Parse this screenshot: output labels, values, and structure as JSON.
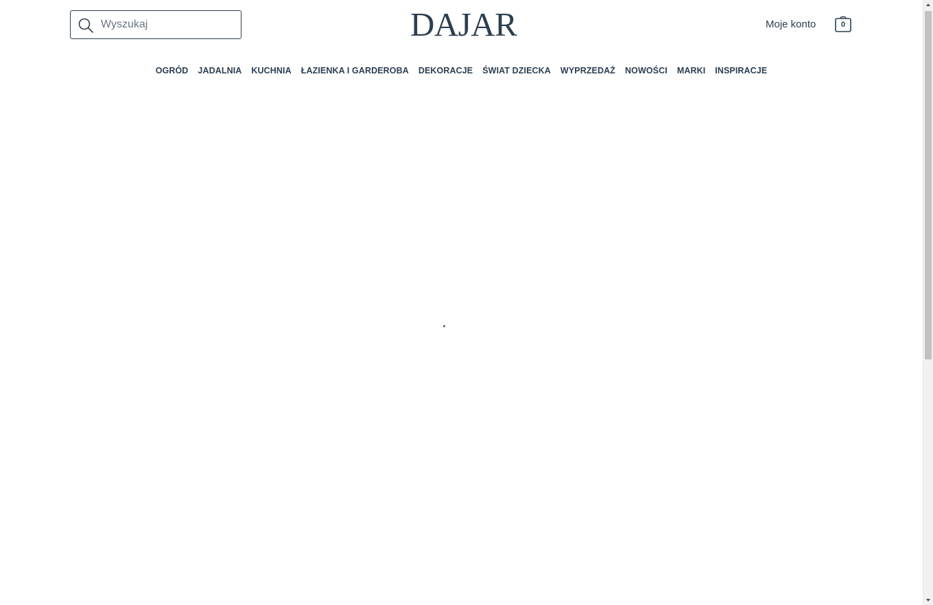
{
  "header": {
    "search": {
      "placeholder": "Wyszukaj",
      "value": "",
      "icon": "search-icon"
    },
    "logo_text": "DAJAR",
    "account_label": "Moje konto",
    "cart": {
      "icon": "shopping-bag-icon",
      "count": "0"
    }
  },
  "nav": {
    "items": [
      {
        "label": "OGRÓD"
      },
      {
        "label": "JADALNIA"
      },
      {
        "label": "KUCHNIA"
      },
      {
        "label": "ŁAZIENKA I GARDEROBA"
      },
      {
        "label": "DEKORACJE"
      },
      {
        "label": "ŚWIAT DZIECKA"
      },
      {
        "label": "WYPRZEDAŻ"
      },
      {
        "label": "NOWOŚCI"
      },
      {
        "label": "MARKI"
      },
      {
        "label": "INSPIRACJE"
      }
    ]
  },
  "colors": {
    "primary": "#2c3e50",
    "background": "#ffffff",
    "scrollbar_thumb": "#c1c1c1"
  }
}
